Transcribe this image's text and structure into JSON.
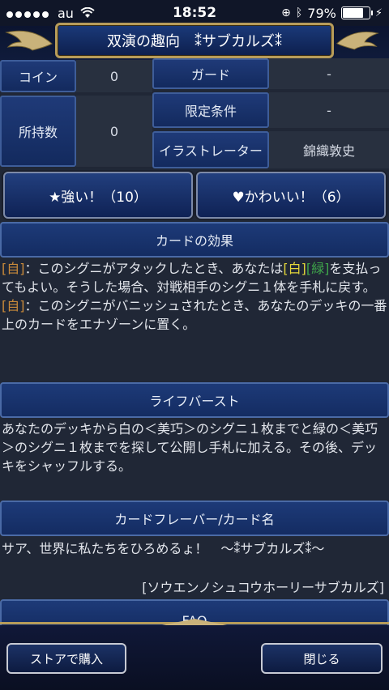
{
  "status_bar": {
    "carrier": "au",
    "time": "18:52",
    "battery": "79%"
  },
  "header": {
    "title": "双演の趣向　⁑サブカルズ⁑"
  },
  "card_table": {
    "rows": [
      {
        "label": "コイン",
        "value": "0"
      },
      {
        "label": "所持数",
        "value": "0"
      }
    ],
    "right_rows": [
      {
        "label": "ガード",
        "value": "-"
      },
      {
        "label": "限定条件",
        "value": "-"
      },
      {
        "label": "イラストレーター",
        "value": "錦織敦史"
      }
    ]
  },
  "reactions": {
    "strong": "★強い！（10）",
    "cute": "♥かわいい！（6）"
  },
  "effect": {
    "heading": "カードの効果",
    "line1_tag": "[自]",
    "line1_a": "：このシグニがアタックしたとき、あなたは",
    "line1_white": "[白]",
    "line1_green": "[緑]",
    "line1_b": "を支払ってもよい。そうした場合、対戦相手のシグニ１体を手札に戻す。",
    "line2_tag": "[自]",
    "line2_a": "：このシグニがバニッシュされたとき、あなたのデッキの一番上のカードをエナゾーンに置く。"
  },
  "life_burst": {
    "heading": "ライフバースト",
    "text": "あなたのデッキから白の＜美巧＞のシグニ１枚までと緑の＜美巧＞のシグニ１枚までを探して公開し手札に加える。その後、デッキをシャッフルする。"
  },
  "flavor": {
    "heading": "カードフレーバー/カード名",
    "text": "サア、世界に私たちをひろめるょ！　〜⁑サブカルズ⁑〜",
    "reading": "[ソウエンノシュコウホーリーサブカルズ]"
  },
  "faq": {
    "heading": "FAQ"
  },
  "footer": {
    "buy_label": "ストアで購入",
    "close_label": "閉じる"
  },
  "colors": {
    "accent_gold": "#b89d5a",
    "panel_blue": "#1d3a78",
    "bg": "#202736"
  }
}
